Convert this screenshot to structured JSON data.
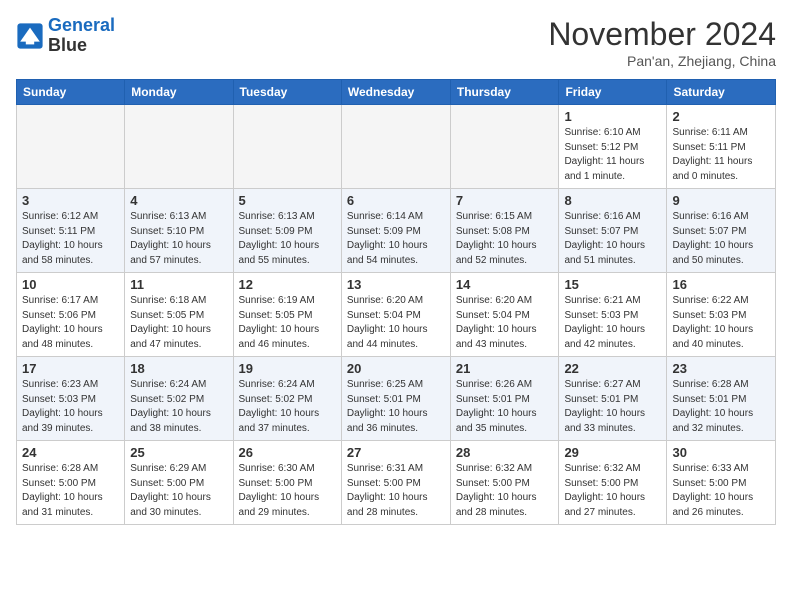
{
  "header": {
    "logo_line1": "General",
    "logo_line2": "Blue",
    "month": "November 2024",
    "location": "Pan'an, Zhejiang, China"
  },
  "weekdays": [
    "Sunday",
    "Monday",
    "Tuesday",
    "Wednesday",
    "Thursday",
    "Friday",
    "Saturday"
  ],
  "weeks": [
    [
      {
        "day": "",
        "info": ""
      },
      {
        "day": "",
        "info": ""
      },
      {
        "day": "",
        "info": ""
      },
      {
        "day": "",
        "info": ""
      },
      {
        "day": "",
        "info": ""
      },
      {
        "day": "1",
        "info": "Sunrise: 6:10 AM\nSunset: 5:12 PM\nDaylight: 11 hours\nand 1 minute."
      },
      {
        "day": "2",
        "info": "Sunrise: 6:11 AM\nSunset: 5:11 PM\nDaylight: 11 hours\nand 0 minutes."
      }
    ],
    [
      {
        "day": "3",
        "info": "Sunrise: 6:12 AM\nSunset: 5:11 PM\nDaylight: 10 hours\nand 58 minutes."
      },
      {
        "day": "4",
        "info": "Sunrise: 6:13 AM\nSunset: 5:10 PM\nDaylight: 10 hours\nand 57 minutes."
      },
      {
        "day": "5",
        "info": "Sunrise: 6:13 AM\nSunset: 5:09 PM\nDaylight: 10 hours\nand 55 minutes."
      },
      {
        "day": "6",
        "info": "Sunrise: 6:14 AM\nSunset: 5:09 PM\nDaylight: 10 hours\nand 54 minutes."
      },
      {
        "day": "7",
        "info": "Sunrise: 6:15 AM\nSunset: 5:08 PM\nDaylight: 10 hours\nand 52 minutes."
      },
      {
        "day": "8",
        "info": "Sunrise: 6:16 AM\nSunset: 5:07 PM\nDaylight: 10 hours\nand 51 minutes."
      },
      {
        "day": "9",
        "info": "Sunrise: 6:16 AM\nSunset: 5:07 PM\nDaylight: 10 hours\nand 50 minutes."
      }
    ],
    [
      {
        "day": "10",
        "info": "Sunrise: 6:17 AM\nSunset: 5:06 PM\nDaylight: 10 hours\nand 48 minutes."
      },
      {
        "day": "11",
        "info": "Sunrise: 6:18 AM\nSunset: 5:05 PM\nDaylight: 10 hours\nand 47 minutes."
      },
      {
        "day": "12",
        "info": "Sunrise: 6:19 AM\nSunset: 5:05 PM\nDaylight: 10 hours\nand 46 minutes."
      },
      {
        "day": "13",
        "info": "Sunrise: 6:20 AM\nSunset: 5:04 PM\nDaylight: 10 hours\nand 44 minutes."
      },
      {
        "day": "14",
        "info": "Sunrise: 6:20 AM\nSunset: 5:04 PM\nDaylight: 10 hours\nand 43 minutes."
      },
      {
        "day": "15",
        "info": "Sunrise: 6:21 AM\nSunset: 5:03 PM\nDaylight: 10 hours\nand 42 minutes."
      },
      {
        "day": "16",
        "info": "Sunrise: 6:22 AM\nSunset: 5:03 PM\nDaylight: 10 hours\nand 40 minutes."
      }
    ],
    [
      {
        "day": "17",
        "info": "Sunrise: 6:23 AM\nSunset: 5:03 PM\nDaylight: 10 hours\nand 39 minutes."
      },
      {
        "day": "18",
        "info": "Sunrise: 6:24 AM\nSunset: 5:02 PM\nDaylight: 10 hours\nand 38 minutes."
      },
      {
        "day": "19",
        "info": "Sunrise: 6:24 AM\nSunset: 5:02 PM\nDaylight: 10 hours\nand 37 minutes."
      },
      {
        "day": "20",
        "info": "Sunrise: 6:25 AM\nSunset: 5:01 PM\nDaylight: 10 hours\nand 36 minutes."
      },
      {
        "day": "21",
        "info": "Sunrise: 6:26 AM\nSunset: 5:01 PM\nDaylight: 10 hours\nand 35 minutes."
      },
      {
        "day": "22",
        "info": "Sunrise: 6:27 AM\nSunset: 5:01 PM\nDaylight: 10 hours\nand 33 minutes."
      },
      {
        "day": "23",
        "info": "Sunrise: 6:28 AM\nSunset: 5:01 PM\nDaylight: 10 hours\nand 32 minutes."
      }
    ],
    [
      {
        "day": "24",
        "info": "Sunrise: 6:28 AM\nSunset: 5:00 PM\nDaylight: 10 hours\nand 31 minutes."
      },
      {
        "day": "25",
        "info": "Sunrise: 6:29 AM\nSunset: 5:00 PM\nDaylight: 10 hours\nand 30 minutes."
      },
      {
        "day": "26",
        "info": "Sunrise: 6:30 AM\nSunset: 5:00 PM\nDaylight: 10 hours\nand 29 minutes."
      },
      {
        "day": "27",
        "info": "Sunrise: 6:31 AM\nSunset: 5:00 PM\nDaylight: 10 hours\nand 28 minutes."
      },
      {
        "day": "28",
        "info": "Sunrise: 6:32 AM\nSunset: 5:00 PM\nDaylight: 10 hours\nand 28 minutes."
      },
      {
        "day": "29",
        "info": "Sunrise: 6:32 AM\nSunset: 5:00 PM\nDaylight: 10 hours\nand 27 minutes."
      },
      {
        "day": "30",
        "info": "Sunrise: 6:33 AM\nSunset: 5:00 PM\nDaylight: 10 hours\nand 26 minutes."
      }
    ]
  ]
}
